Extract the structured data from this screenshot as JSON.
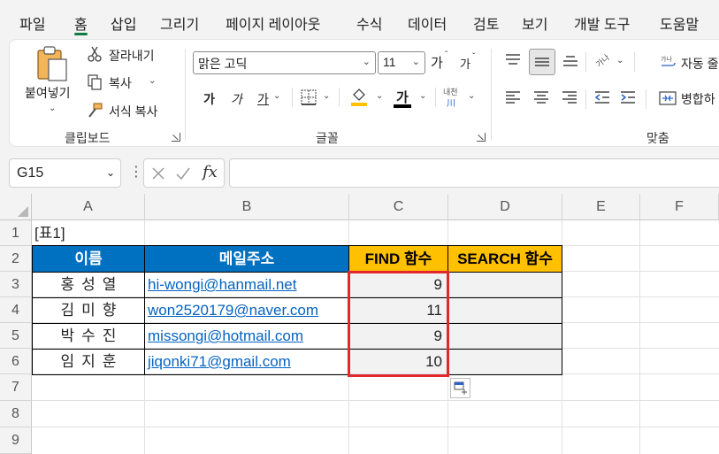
{
  "menu": [
    "파일",
    "홈",
    "삽입",
    "그리기",
    "페이지 레이아웃",
    "수식",
    "데이터",
    "검토",
    "보기",
    "개발 도구",
    "도움말"
  ],
  "ribbon": {
    "clipboard": {
      "paste": "붙여넣기",
      "cut": "잘라내기",
      "copy": "복사",
      "format_painter": "서식 복사",
      "label": "클립보드"
    },
    "font": {
      "font_name": "맑은 고딕",
      "font_size": "11",
      "grow_glyph": "가",
      "shrink_glyph": "가",
      "bold": "가",
      "italic": "가",
      "underline": "가",
      "font_color_glyph": "가",
      "phonetic_top": "내천",
      "phonetic_bottom": "川",
      "label": "글꼴"
    },
    "alignment": {
      "orientation": "가나",
      "wrap": "자동 줄",
      "merge": "병합하",
      "label": "맞춤"
    },
    "accent": "#107c41",
    "fill_color": "#ffc000",
    "font_color": "#000000"
  },
  "formula_bar": {
    "name_box": "G15",
    "fx": "fx",
    "formula": ""
  },
  "sheet": {
    "columns": [
      "A",
      "B",
      "C",
      "D",
      "E",
      "F"
    ],
    "rows": [
      "1",
      "2",
      "3",
      "4",
      "5",
      "6",
      "7",
      "8",
      "9"
    ],
    "title_cell": "[표1]",
    "headers": [
      "이름",
      "메일주소",
      "FIND 함수",
      "SEARCH 함수"
    ],
    "data": [
      {
        "name": "홍성열",
        "email": "hi-wongi@hanmail.net",
        "find": "9",
        "search": ""
      },
      {
        "name": "김미향",
        "email": "won2520179@naver.com",
        "find": "11",
        "search": ""
      },
      {
        "name": "박수진",
        "email": "missongi@hotmail.com",
        "find": "9",
        "search": ""
      },
      {
        "name": "임지훈",
        "email": "jiqonki71@gmail.com",
        "find": "10",
        "search": ""
      }
    ],
    "header_blue": "#0070c0",
    "header_gold": "#ffc000",
    "highlight_border": "#e0282e"
  }
}
